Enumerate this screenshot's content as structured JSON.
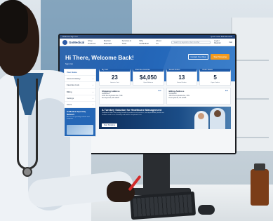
{
  "topstrip": {
    "left": "Welcome   Sign Out",
    "right": "Quick Order   800-555-0100"
  },
  "brand": {
    "name": "GoMedical"
  },
  "nav": {
    "items": [
      "Shop Products",
      "Medical Materials",
      "Services & Tools",
      "Why GoMedical",
      "About Us"
    ],
    "search_placeholder": "Search by keyword or item number",
    "right_items": [
      "Login / Register",
      "Cart"
    ]
  },
  "hero": {
    "title": "Hi There, Welcome Back!",
    "subtitle": "Sign Out",
    "btn_outline": "Contact Your Rep",
    "btn_primary": "Start Shopping"
  },
  "sidebar": {
    "items": [
      {
        "label": "Your Home",
        "active": true
      },
      {
        "label": "Account History",
        "active": false
      },
      {
        "label": "Favorites Lists",
        "active": false
      },
      {
        "label": "Billing",
        "active": false
      },
      {
        "label": "Settings",
        "active": false
      },
      {
        "label": "Users",
        "active": false
      }
    ],
    "promo_title": "GoMedical Specialty Network",
    "promo_desc": "Access our specialty network and programs"
  },
  "stats": [
    {
      "label": "My Cart",
      "value": "23",
      "sub": "Items in Cart"
    },
    {
      "label": "Past Due Invoices",
      "value": "$4,050",
      "sub": "Open Balance"
    },
    {
      "label": "Saved Orders",
      "value": "13",
      "sub": "Saved Orders"
    },
    {
      "label": "Order Status",
      "value": "5",
      "sub": "Open Orders"
    }
  ],
  "addresses": {
    "shipping": {
      "title": "Shipping Address",
      "edit": "Edit",
      "lines": [
        "GoMedical",
        "1234 Pennsylvania Ave, STE",
        "Pennsylvania, PA 12345"
      ]
    },
    "billing": {
      "title": "Billing Address",
      "edit": "Edit",
      "lines": [
        "GoMedical",
        "1234 Pennsylvania Ave, STE",
        "Pennsylvania, PA 12345"
      ]
    }
  },
  "banner": {
    "title": "A Turnkey Solution for Healthcare Management",
    "desc": "GoMedical offers the quality, breadth of products and services, and dependability healthcare facilities need to run smoothly and deliver exceptional care.",
    "button": "Start Shopping"
  },
  "icons": [
    "cart-icon",
    "invoice-icon",
    "saved-orders-icon",
    "truck-icon"
  ]
}
